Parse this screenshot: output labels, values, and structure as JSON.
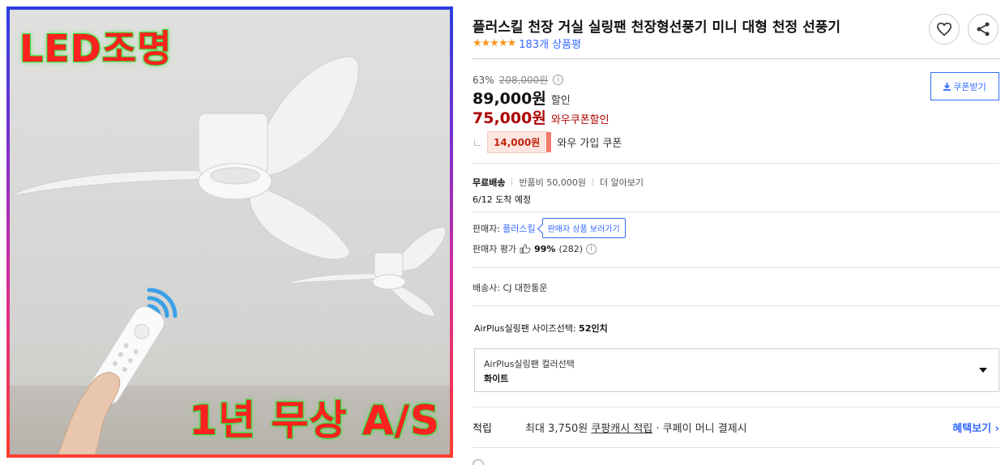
{
  "image": {
    "promo_top": "LED조명",
    "promo_bottom": "1년 무상 A/S",
    "colors": {
      "border_top": "#2b3fe0",
      "border_bottom": "#ff3d2e",
      "promo_fill": "#ff2020",
      "promo_stroke": "#2fd12f"
    }
  },
  "product": {
    "title": "플러스킬 천장 거실 실링팬 천장형선풍기 미니 대형 천정 선풍기",
    "stars": "★★★★★",
    "rating_fraction": 1.0,
    "review_count": "183개 상품평"
  },
  "actions": {
    "wish_icon": "heart-icon",
    "share_icon": "share-icon"
  },
  "price": {
    "discount_rate": "63%",
    "original_price": "208,000원",
    "info_icon": "i",
    "sale_price": "89,000원",
    "sale_suffix": "할인",
    "wow_price": "75,000원",
    "wow_suffix": "와우쿠폰할인",
    "coupon_amount": "14,000원",
    "coupon_label": "와우 가입 쿠폰",
    "coupon_button": "쿠폰받기"
  },
  "shipping": {
    "free": "무료배송",
    "return_fee": "반품비 50,000원",
    "more": "더 알아보기",
    "arrival": "6/12 도착 예정"
  },
  "seller": {
    "label": "판매자:",
    "name": "플러스킬",
    "tooltip": "판매자 상품 보러가기",
    "rating_label": "판매자 평가",
    "rating_pct": "99%",
    "rating_count": "(282)"
  },
  "carrier": "배송사: CJ 대한통운",
  "options": {
    "size_label": "AirPlus실링팬 사이즈선택:",
    "size_value": "52인치",
    "color_label": "AirPlus실링팬 컬러선택",
    "color_value": "화이트"
  },
  "points": {
    "label": "적립",
    "text_prefix": "최대 3,750원",
    "text_link": "쿠팡캐시 적립",
    "text_suffix": "· 쿠페이 머니 결제시",
    "benefit_link": "혜택보기 ›"
  },
  "accent_color": "#346aff",
  "price_red": "#ae0000"
}
